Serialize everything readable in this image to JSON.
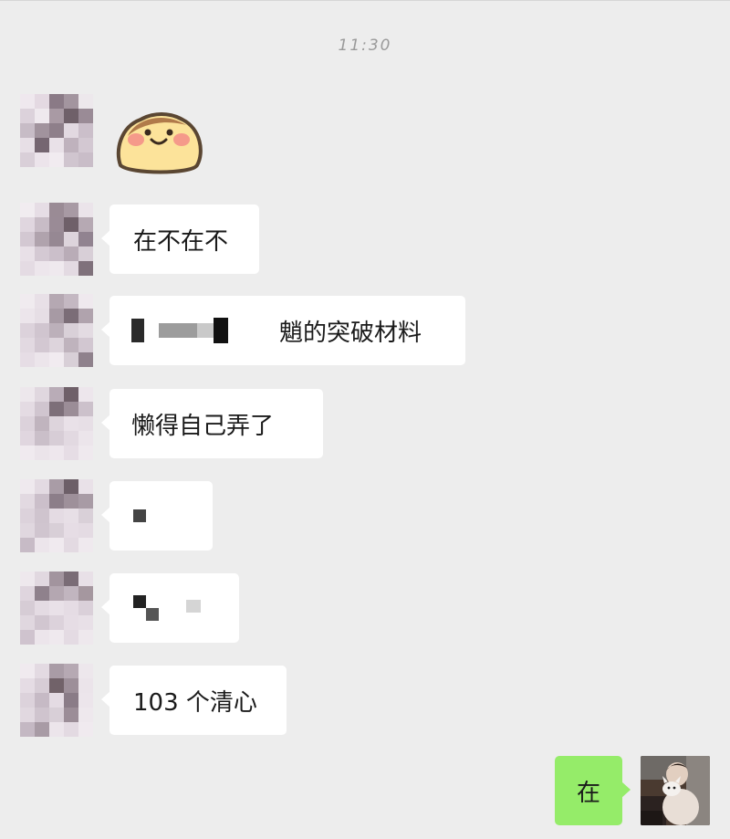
{
  "timestamp": "11:30",
  "messages": [
    {
      "type": "sticker",
      "sender": "other",
      "icon": "smiling-bun-sticker-icon"
    },
    {
      "type": "text",
      "sender": "other",
      "text": "在不在不"
    },
    {
      "type": "text",
      "sender": "other",
      "text_visible": "魈的突破材料",
      "redacted": true
    },
    {
      "type": "text",
      "sender": "other",
      "text": "懒得自己弄了"
    },
    {
      "type": "text",
      "sender": "other",
      "redacted": true
    },
    {
      "type": "text",
      "sender": "other",
      "redacted": true
    },
    {
      "type": "text",
      "sender": "other",
      "text": "103 个清心"
    },
    {
      "type": "text",
      "sender": "self",
      "text": "在"
    }
  ],
  "colors": {
    "background": "#ededed",
    "other_bubble": "#ffffff",
    "self_bubble": "#95ec69",
    "timestamp": "#9a9a9a"
  }
}
